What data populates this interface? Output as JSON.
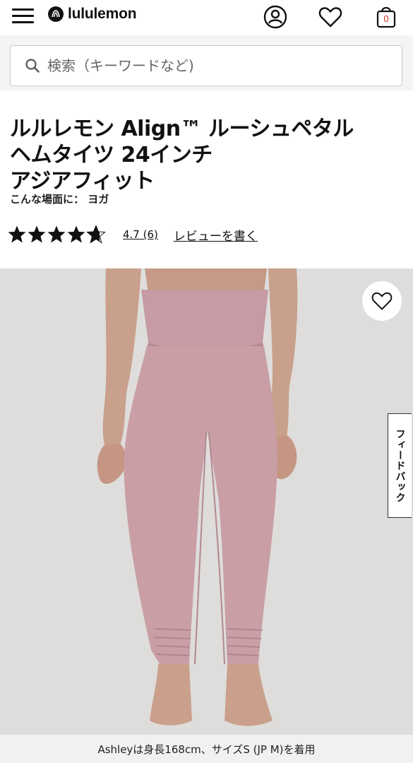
{
  "header": {
    "brand": "lululemon",
    "bag_count": "0"
  },
  "search": {
    "placeholder": "検索（キーワードなど)"
  },
  "product": {
    "title_line1": "ルルレモン Align™ ルーシュペタル",
    "title_line2": "ヘムタイツ 24インチ",
    "title_line3": "アジアフィット",
    "activity": "こんな場面に： ヨガ",
    "rating_value": "4.7",
    "review_count": "(6)",
    "write_review": "レビューを書く",
    "stars": 4.7
  },
  "gallery": {
    "feedback_label": "フィードバック",
    "caption": "Ashleyは身長168cm、サイズS (JP M)を着用"
  },
  "colors": {
    "accent_red": "#d22e1e",
    "image_bg": "#dedddb",
    "product_pink": "#c99ea5"
  }
}
